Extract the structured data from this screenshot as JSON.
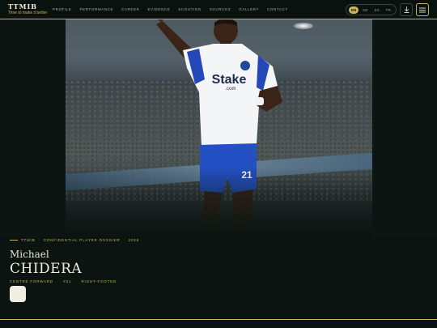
{
  "brand": {
    "title": "TTMIB",
    "tagline": "Time to make it better"
  },
  "nav": [
    "PROFILE",
    "PERFORMANCE",
    "CAREER",
    "EVIDENCE",
    "SCOUTING",
    "SOURCES",
    "GALLERY",
    "CONTACT"
  ],
  "languages": [
    {
      "code": "EN",
      "active": true
    },
    {
      "code": "DE",
      "active": false
    },
    {
      "code": "ES",
      "active": false
    },
    {
      "code": "FR",
      "active": false
    }
  ],
  "icons": {
    "download": "download-icon",
    "menu": "menu-icon"
  },
  "hero": {
    "shirt_sponsor": "Stake",
    "shirt_sponsor_sub": ".com",
    "shirt_number": "21"
  },
  "dossier": {
    "brand": "TTMIB",
    "label": "CONFIDENTIAL PLAYER DOSSIER",
    "year": "2026",
    "first_name": "Michael",
    "last_name": "CHIDERA",
    "position": "CENTRE FORWARD",
    "number": "#21",
    "foot": "RIGHT-FOOTED"
  },
  "colors": {
    "accent": "#c8b45a",
    "background": "#0b1410",
    "text": "#e8e4d4"
  }
}
